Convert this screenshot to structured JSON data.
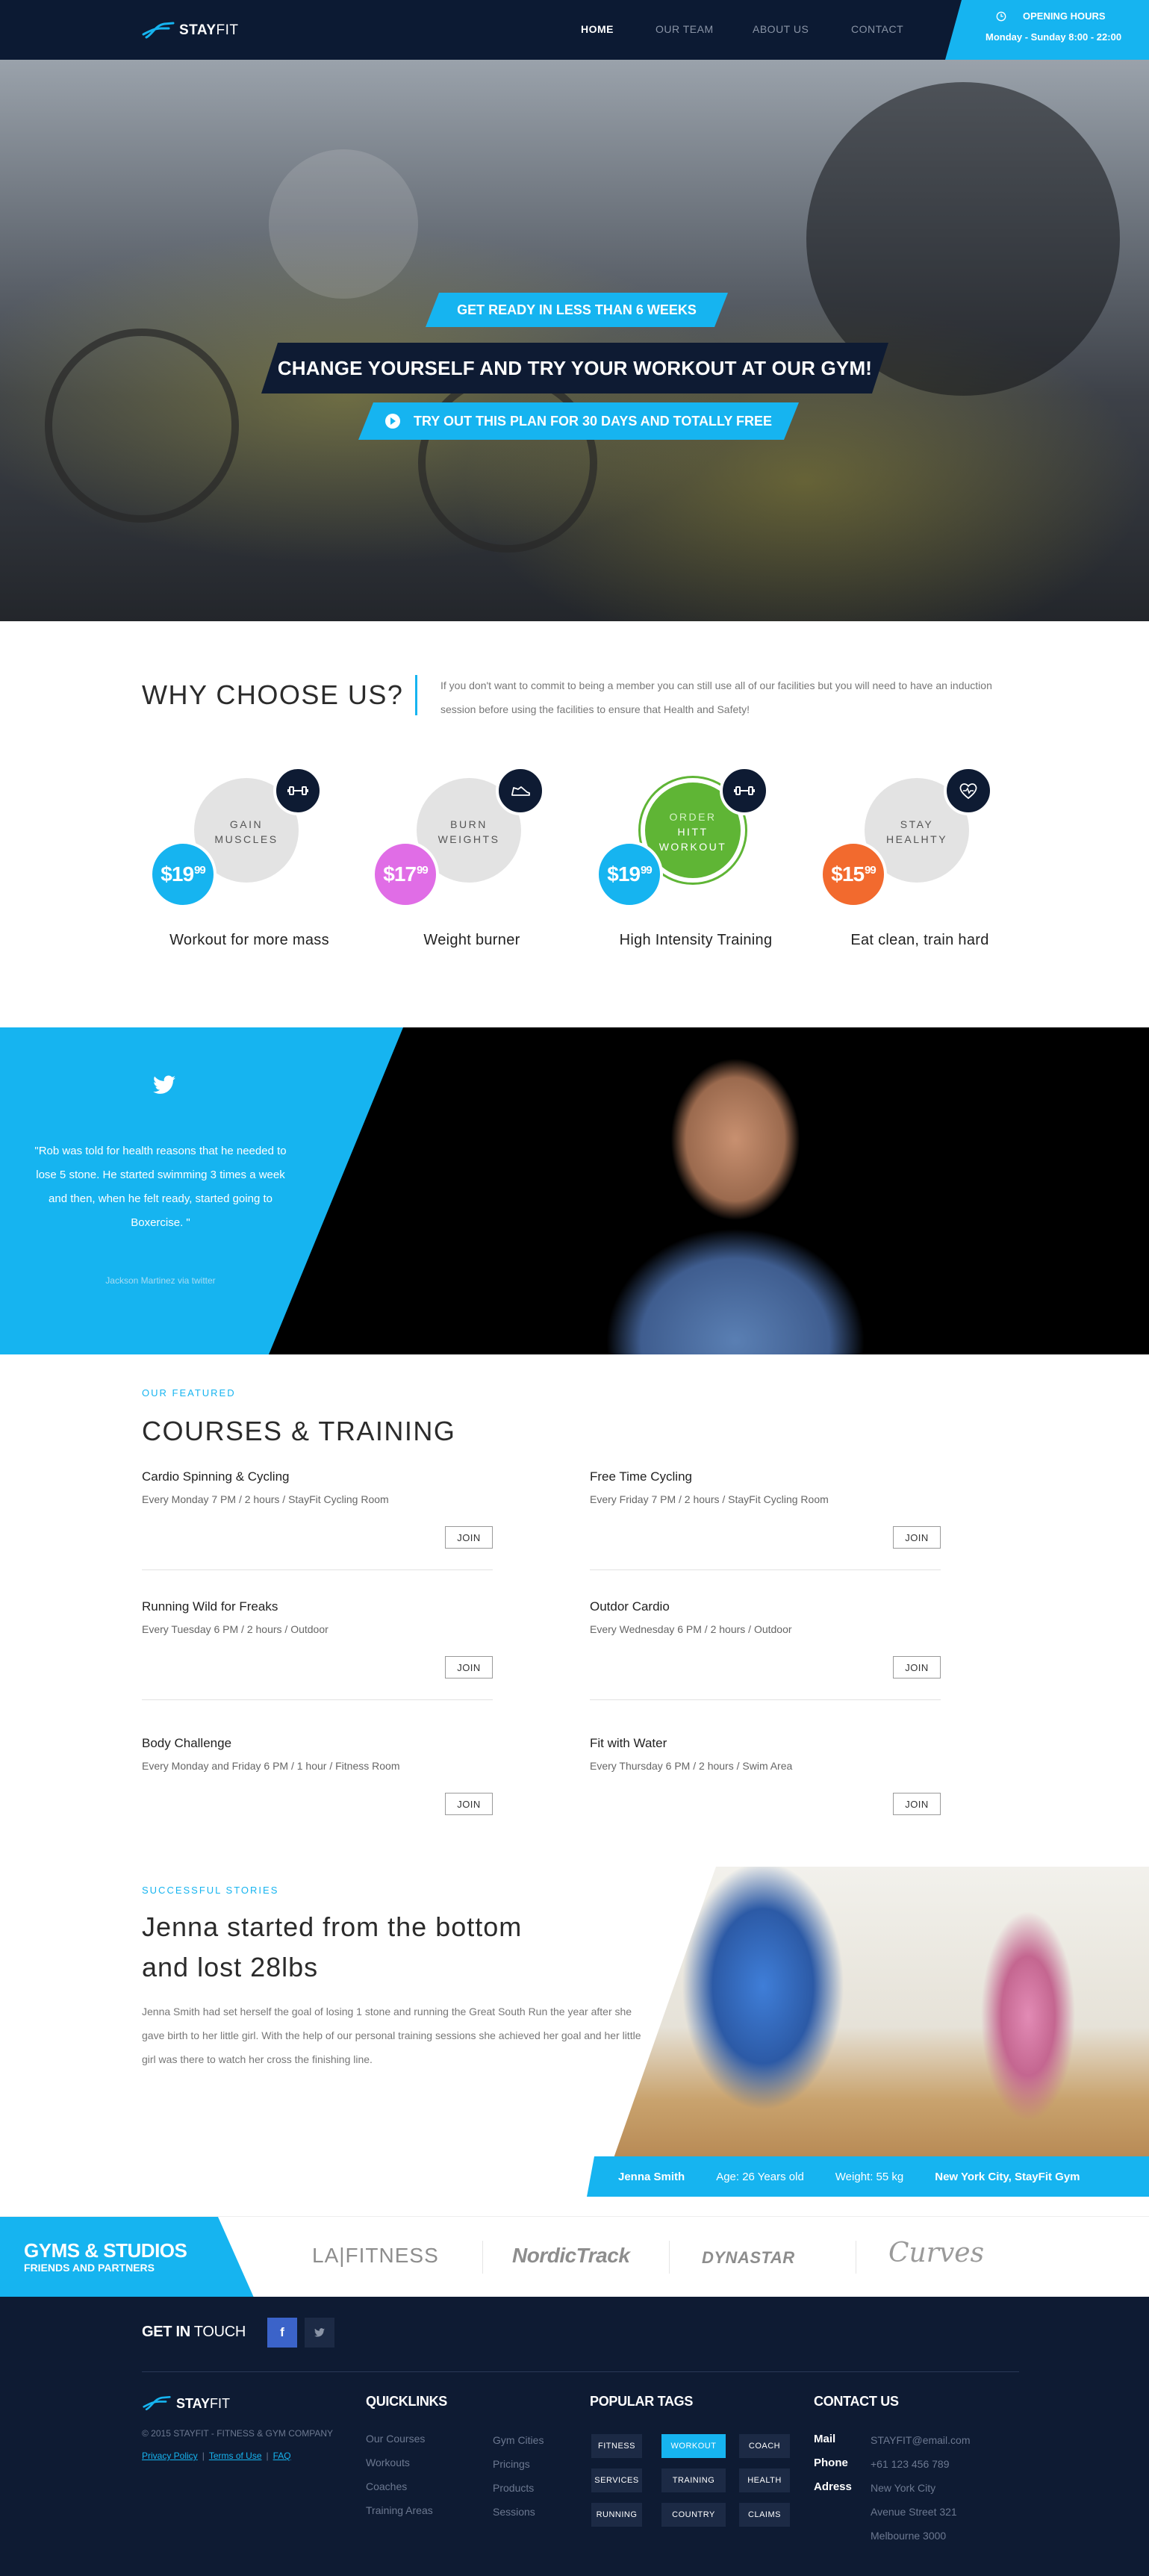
{
  "brand": {
    "name_bold": "STAY",
    "name_light": "FIT"
  },
  "nav": {
    "items": [
      "HOME",
      "OUR TEAM",
      "ABOUT US",
      "CONTACT"
    ],
    "active": "HOME"
  },
  "hours": {
    "label": "OPENING HOURS",
    "value": "Monday - Sunday 8:00 - 22:00",
    "icon": "clock-icon"
  },
  "hero": {
    "tag1": "GET READY IN LESS THAN 6 WEEKS",
    "tag2": "CHANGE YOURSELF AND TRY YOUR WORKOUT AT OUR GYM!",
    "tag3": "TRY OUT THIS PLAN FOR 30 DAYS AND TOTALLY FREE"
  },
  "why": {
    "title": "WHY CHOOSE US?",
    "desc": "If you don't want to commit to being a member you can still use all of our facilities but you will need to have an induction session before using the facilities to ensure that Health and Safety!",
    "packages": [
      {
        "line1": "GAIN",
        "line2": "MUSCLES",
        "line3": "",
        "price": "$19",
        "cents": "99",
        "title": "Workout for more mass",
        "price_color": "#16b4f0",
        "icon": "dumbbell-icon"
      },
      {
        "line1": "BURN",
        "line2": "WEIGHTS",
        "line3": "",
        "price": "$17",
        "cents": "99",
        "title": "Weight burner",
        "price_color": "#e06de6",
        "icon": "shoe-icon"
      },
      {
        "line1": "ORDER",
        "line2": "HITT",
        "line3": "WORKOUT",
        "price": "$19",
        "cents": "99",
        "title": "High Intensity Training",
        "price_color": "#16b4f0",
        "icon": "dumbbell-icon"
      },
      {
        "line1": "STAY",
        "line2": "HEALHTY",
        "line3": "",
        "price": "$15",
        "cents": "99",
        "title": "Eat clean, train hard",
        "price_color": "#f26a2e",
        "icon": "heart-pulse-icon"
      }
    ]
  },
  "testimonial": {
    "quote": "\"Rob was told for health reasons that he needed to lose 5 stone. He started swimming 3 times a week and then, when he felt ready, started going to Boxercise. \"",
    "author": "Jackson Martinez via twitter"
  },
  "courses": {
    "kicker": "OUR FEATURED",
    "title": "COURSES & TRAINING",
    "join_label": "JOIN",
    "items": [
      {
        "name": "Cardio Spinning & Cycling",
        "meta": "Every Monday 7 PM / 2 hours  / StayFit Cycling Room"
      },
      {
        "name": "Free Time Cycling",
        "meta": "Every Friday 7 PM / 2 hours  / StayFit Cycling Room"
      },
      {
        "name": "Running Wild for Freaks",
        "meta": "Every Tuesday 6 PM / 2 hours  / Outdoor"
      },
      {
        "name": "Outdor Cardio",
        "meta": "Every Wednesday 6 PM / 2 hours  / Outdoor"
      },
      {
        "name": "Body Challenge",
        "meta": "Every Monday and Friday 6 PM / 1 hour  / Fitness Room"
      },
      {
        "name": "Fit with Water",
        "meta": "Every Thursday 6 PM / 2 hours  / Swim Area"
      }
    ]
  },
  "story": {
    "kicker": "SUCCESSFUL STORIES",
    "title": "Jenna started from the bottom and lost 28lbs",
    "text": "Jenna Smith had set herself the goal of losing 1 stone and running the Great South Run the year after she gave birth to her little girl. With the help of our personal training sessions she achieved her goal and her little girl was there to watch her cross the finishing line.",
    "name": "Jenna Smith",
    "age": "Age: 26 Years old",
    "weight": "Weight: 55 kg",
    "location": "New York City,",
    "gym": "StayFit Gym"
  },
  "partners": {
    "label1": "GYMS & STUDIOS",
    "label2": "FRIENDS AND PARTNERS",
    "logos": [
      "LA|FITNESS",
      "NordicTrack",
      "DYNASTAR",
      "Curves"
    ]
  },
  "footer": {
    "get_in_touch_bold": "GET IN",
    "get_in_touch_light": " TOUCH",
    "fb": "f",
    "copyright": "© 2015 STAYFIT - FITNESS & GYM COMPANY",
    "legal": [
      "Privacy Policy",
      "Terms of Use",
      "FAQ"
    ],
    "quicklinks_title": "QUICKLINKS",
    "quicklinks_col1": [
      "Our Courses",
      "Workouts",
      "Coaches",
      "Training Areas"
    ],
    "quicklinks_col2": [
      "Gym Cities",
      "Pricings",
      "Products",
      "Sessions"
    ],
    "tags_title": "POPULAR TAGS",
    "tags": [
      "FITNESS",
      "WORKOUT",
      "COACH",
      "SERVICES",
      "TRAINING",
      "HEALTH",
      "RUNNING",
      "COUNTRY",
      "CLAIMS"
    ],
    "active_tag": "WORKOUT",
    "contact_title": "CONTACT US",
    "contact": {
      "mail_label": "Mail",
      "mail": "STAYFIT@email.com",
      "phone_label": "Phone",
      "phone": "+61 123 456 789",
      "address_label": "Adress",
      "address": [
        "New York City",
        "Avenue Street 321",
        "Melbourne 3000"
      ]
    }
  },
  "colors": {
    "accent": "#16b4f0",
    "navy": "#0e1b33",
    "green": "#5fb535",
    "pink": "#e06de6",
    "orange": "#f26a2e"
  }
}
